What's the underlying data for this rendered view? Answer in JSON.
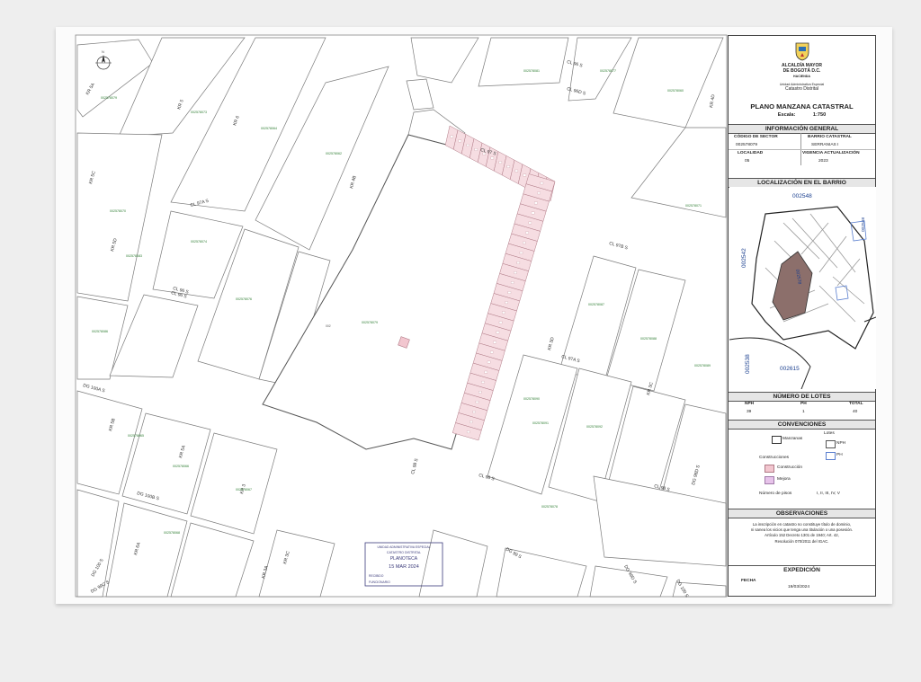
{
  "sheet": {
    "panel": {
      "org": [
        "ALCALDÍA MAYOR",
        "DE BOGOTÁ D.C.",
        "HACIENDA"
      ],
      "org_sub": [
        "Unidad Administrativa Especial",
        "Catastro Distrital"
      ],
      "title": "PLANO MANZANA CATASTRAL",
      "scale_label": "Escala:",
      "scale_value": "1:750",
      "general_info_header": "INFORMACIÓN GENERAL",
      "sector_code_label": "CÓDIGO DE SECTOR",
      "sector_code_value": "002578079",
      "barrio_label": "BARRIO CATASTRAL",
      "barrio_value": "SERRANIAS I",
      "localidad_label": "LOCALIDAD",
      "localidad_value": "05",
      "vigencia_label": "VIGENCIA ACTUALIZACIÓN",
      "vigencia_value": "2023",
      "location_header": "LOCALIZACIÓN EN EL BARRIO",
      "location_codes": {
        "top": "002548",
        "left": "002542",
        "left_low": "002538",
        "bottom": "002615",
        "right": "002548",
        "center": "002578"
      },
      "lots_header": "NÚMERO DE LOTES",
      "lots": [
        {
          "label": "NPH",
          "value": "39"
        },
        {
          "label": "PH",
          "value": "1"
        },
        {
          "label": "TOTAL",
          "value": "40"
        }
      ],
      "conventions_header": "CONVENCIONES",
      "conv_manzanas": "Manzanas",
      "conv_lotes": "Lotes",
      "conv_nph": "NPH",
      "conv_ph": "PH",
      "conv_construcciones": "Construcciones",
      "conv_construccion": "Construcción",
      "conv_mejora": "Mejora",
      "conv_pisos_label": "Número de pisos",
      "conv_pisos_value": "I, II, III, IV, V",
      "observations_header": "OBSERVACIONES",
      "observations": [
        "La inscripción en catastro no constituye título de dominio,",
        "ni sanea los vicios que tenga una titulación o una posesión.",
        "Artículo 152 Decreto 1301 de 1940; Art. 42,",
        "Resolución 070/2011 del IGAC."
      ],
      "expedition_header": "EXPEDICIÓN",
      "fecha_label": "FECHA",
      "fecha_value": "19/03/2024"
    },
    "colors": {
      "lot_fill": "#f6dde2",
      "lot_stroke": "#b07a86",
      "construction": "#f2c6cf",
      "mejora": "#e7c3ea",
      "ph_blue": "#5a7fcf",
      "block_line": "#7a7a7a",
      "code_green": "#2e7d32"
    },
    "map": {
      "streets": [
        "KR 5A",
        "KR 5",
        "KR 6",
        "KR 4B",
        "KR 5C",
        "KR 5D",
        "CL 97A S",
        "CL 97 S",
        "CL 96D S",
        "CL 96 S",
        "CL 96 S",
        "CL 97B S",
        "KR 3D",
        "KR 3C",
        "KR 4D",
        "CL 97A S",
        "CL 98 S",
        "DG 100A S",
        "KR 5B",
        "KR 5A",
        "KR 3",
        "KR 3C",
        "DG 100B S",
        "KR 6A",
        "DG 100 S",
        "KR 3A",
        "DG 99 S",
        "DG 99C S",
        "CL 98 S",
        "CL 96 S",
        "DG 98D S",
        "DG 99D S",
        "CL 98 S",
        "DG 100 S"
      ],
      "block_codes": [
        "002578079",
        "002578073",
        "002578064",
        "002578062",
        "002578077",
        "002578081",
        "002578060",
        "002578071",
        "002578070",
        "002578083",
        "002578074",
        "002578076",
        "002578086",
        "002578087",
        "002578088",
        "002578089",
        "002578090",
        "002578091",
        "002578092",
        "002578065",
        "002578066",
        "002578067",
        "002578068",
        "002578078"
      ],
      "north": "N",
      "stamp": [
        "UNIDAD ADMINISTRATIVA ESPECIAL",
        "CATASTRO DISTRITAL",
        "PLANOTECA",
        "15 MAR 2024",
        "RECIBIDO",
        "FUNCIONARIO"
      ]
    }
  }
}
